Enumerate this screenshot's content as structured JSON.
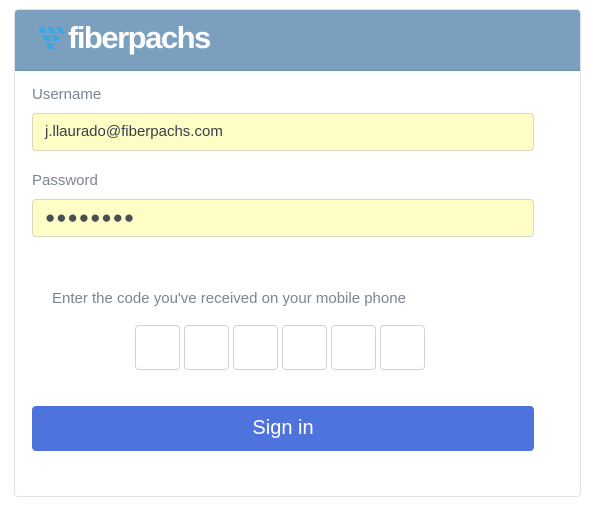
{
  "brand": {
    "name": "fiberpachs",
    "logo_icon": "fiberpachs-logo-mark",
    "colors": {
      "header": "#7a9fbf",
      "logo_mark": "#3aa8e0",
      "primary_button": "#4f73dc",
      "autofill": "#fefdc5"
    }
  },
  "login_form": {
    "username_label": "Username",
    "username_value": "j.llaurado@fiberpachs.com",
    "password_label": "Password",
    "password_value": "●●●●●●●●",
    "code_prompt": "Enter the code you've received on your mobile phone",
    "code_digits": [
      "",
      "",
      "",
      "",
      "",
      ""
    ],
    "submit_label": "Sign in"
  }
}
